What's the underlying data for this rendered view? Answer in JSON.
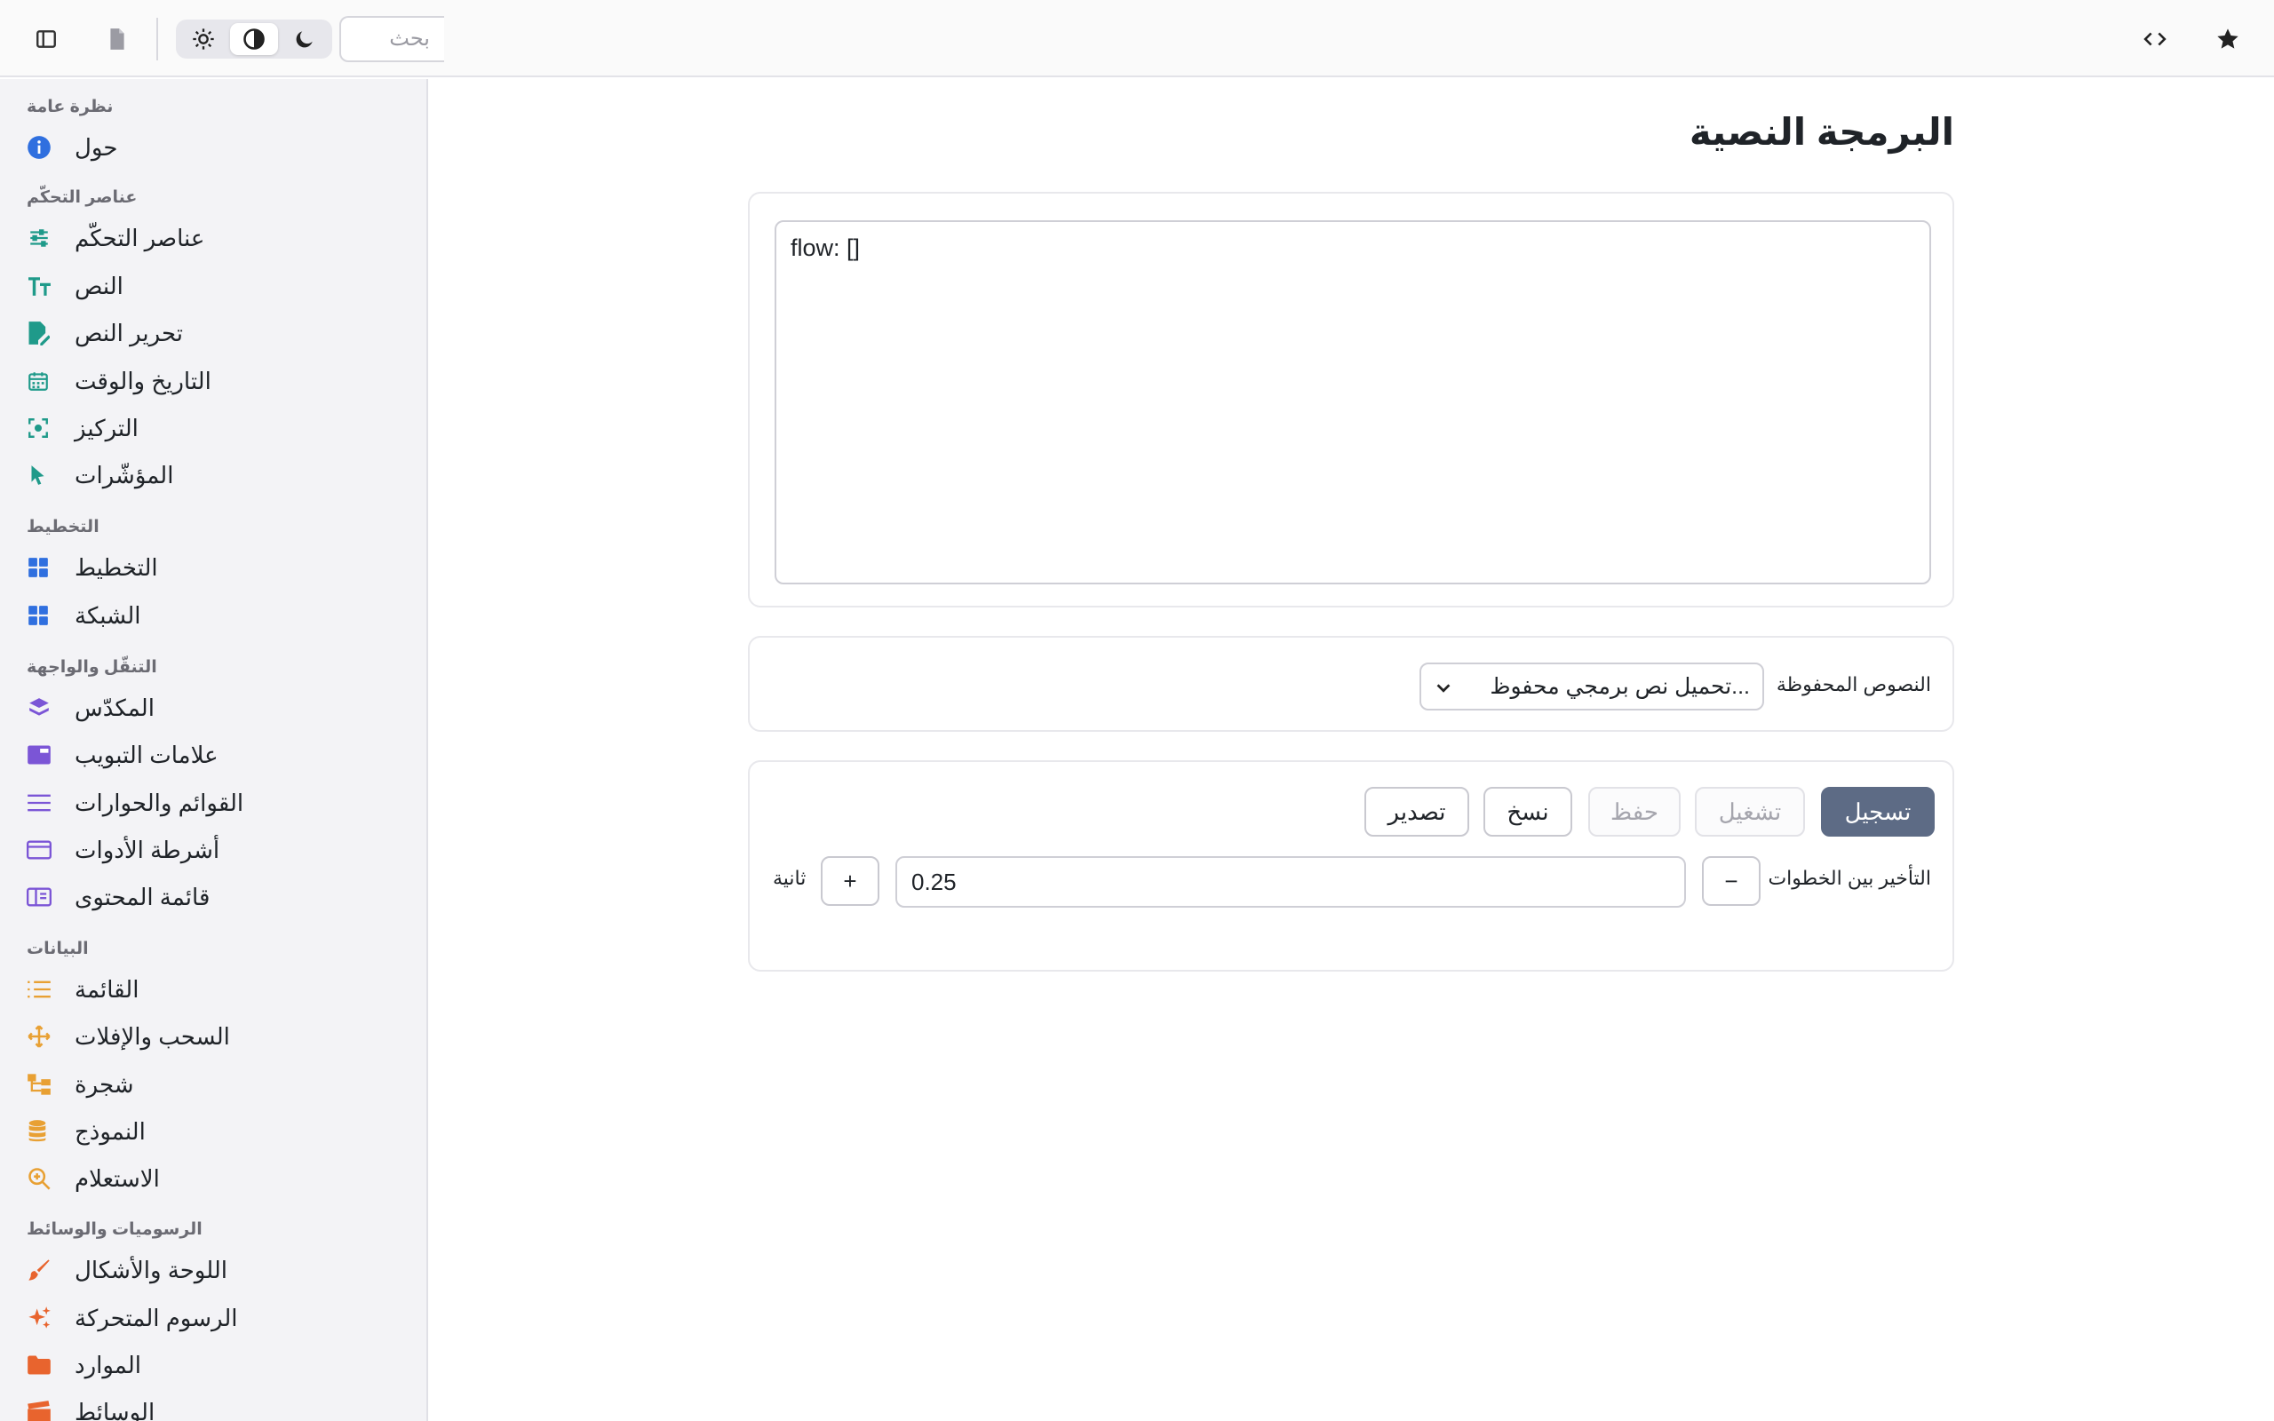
{
  "header": {
    "search_placeholder": "بحث",
    "icons": {
      "sidebar_toggle": "sidebar-toggle-icon",
      "document": "document-icon",
      "theme_light": "sun-icon",
      "theme_auto": "contrast-icon",
      "theme_dark": "moon-icon",
      "code": "code-icon",
      "favorite": "star-icon"
    },
    "active_theme": "auto"
  },
  "sidebar": {
    "sections": [
      {
        "title": "نظرة عامة",
        "items": [
          {
            "label": "حول",
            "icon": "info-icon"
          }
        ]
      },
      {
        "title": "عناصر التحكّم",
        "items": [
          {
            "label": "عناصر التحكّم",
            "icon": "sliders-icon"
          },
          {
            "label": "النص",
            "icon": "text-icon"
          },
          {
            "label": "تحرير النص",
            "icon": "edit-document-icon"
          },
          {
            "label": "التاريخ والوقت",
            "icon": "calendar-icon"
          },
          {
            "label": "التركيز",
            "icon": "focus-icon"
          },
          {
            "label": "المؤشّرات",
            "icon": "cursor-icon"
          }
        ]
      },
      {
        "title": "التخطيط",
        "items": [
          {
            "label": "التخطيط",
            "icon": "layout-icon"
          },
          {
            "label": "الشبكة",
            "icon": "grid-icon"
          }
        ]
      },
      {
        "title": "التنقّل والواجهة",
        "items": [
          {
            "label": "المكدّس",
            "icon": "stack-icon"
          },
          {
            "label": "علامات التبويب",
            "icon": "tabs-icon"
          },
          {
            "label": "القوائم والحوارات",
            "icon": "menu-icon"
          },
          {
            "label": "أشرطة الأدوات",
            "icon": "toolbar-icon"
          },
          {
            "label": "قائمة المحتوى",
            "icon": "content-list-icon"
          }
        ]
      },
      {
        "title": "البيانات",
        "items": [
          {
            "label": "القائمة",
            "icon": "list-icon"
          },
          {
            "label": "السحب والإفلات",
            "icon": "move-icon"
          },
          {
            "label": "شجرة",
            "icon": "tree-icon"
          },
          {
            "label": "النموذج",
            "icon": "database-icon"
          },
          {
            "label": "الاستعلام",
            "icon": "query-icon"
          }
        ]
      },
      {
        "title": "الرسوميات والوسائط",
        "items": [
          {
            "label": "اللوحة والأشكال",
            "icon": "brush-icon"
          },
          {
            "label": "الرسوم المتحركة",
            "icon": "sparkles-icon"
          },
          {
            "label": "الموارد",
            "icon": "folder-icon"
          },
          {
            "label": "الوسائط",
            "icon": "clapperboard-icon"
          }
        ]
      }
    ],
    "colors": {
      "blue": "#2f6fdf",
      "teal": "#1f9a8a",
      "purple": "#7b55d6",
      "orange": "#e8a033",
      "red_orange": "#e8642e"
    }
  },
  "main": {
    "title": "البرمجة النصية",
    "editor_value": "flow: []",
    "saved_scripts": {
      "label": "النصوص المحفوظة",
      "selected": "...تحميل نص برمجي محفوظ"
    },
    "actions": {
      "record": "تسجيل",
      "run": "تشغيل",
      "save": "حفظ",
      "copy": "نسخ",
      "export": "تصدير"
    },
    "delay": {
      "label": "التأخير بين الخطوات",
      "value": "0.25",
      "unit": "ثانية",
      "decrement": "−",
      "increment": "+"
    },
    "colors": {
      "primary_button": "#5d6b85"
    }
  }
}
